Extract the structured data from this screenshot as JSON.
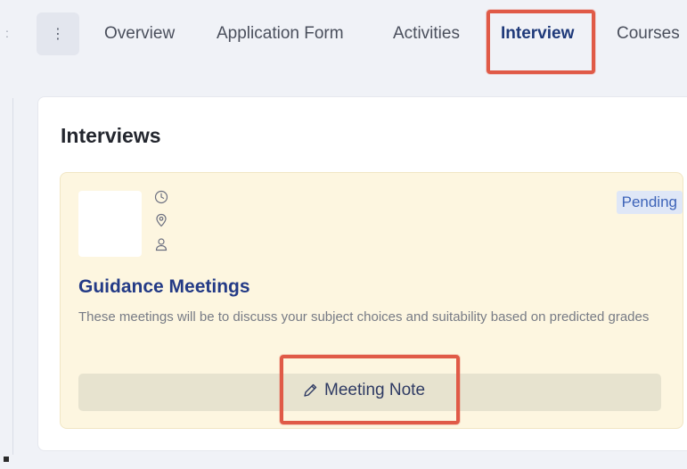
{
  "nav": {
    "more_icon": "vertical-ellipsis-icon",
    "more_glyph": "⋮",
    "tabs": [
      {
        "label": "Overview"
      },
      {
        "label": "Application Form"
      },
      {
        "label": "Activities"
      },
      {
        "label": "Interview"
      },
      {
        "label": "Courses"
      }
    ],
    "active_tab": "Interview"
  },
  "card": {
    "title": "Interviews"
  },
  "interview": {
    "title": "Guidance Meetings",
    "status": "Pending",
    "description": "These meetings will be to discuss your subject choices and suitability based on predicted grades",
    "meta_icons": [
      "clock-icon",
      "location-pin-icon",
      "person-icon"
    ],
    "note_button_label": "Meeting Note",
    "note_button_icon": "pencil-icon"
  },
  "colors": {
    "highlight": "#e05a47",
    "active_tab": "#1f3a7a",
    "item_background": "#fdf6e0",
    "badge_text": "#3d63b8",
    "title_blue": "#233a86"
  }
}
